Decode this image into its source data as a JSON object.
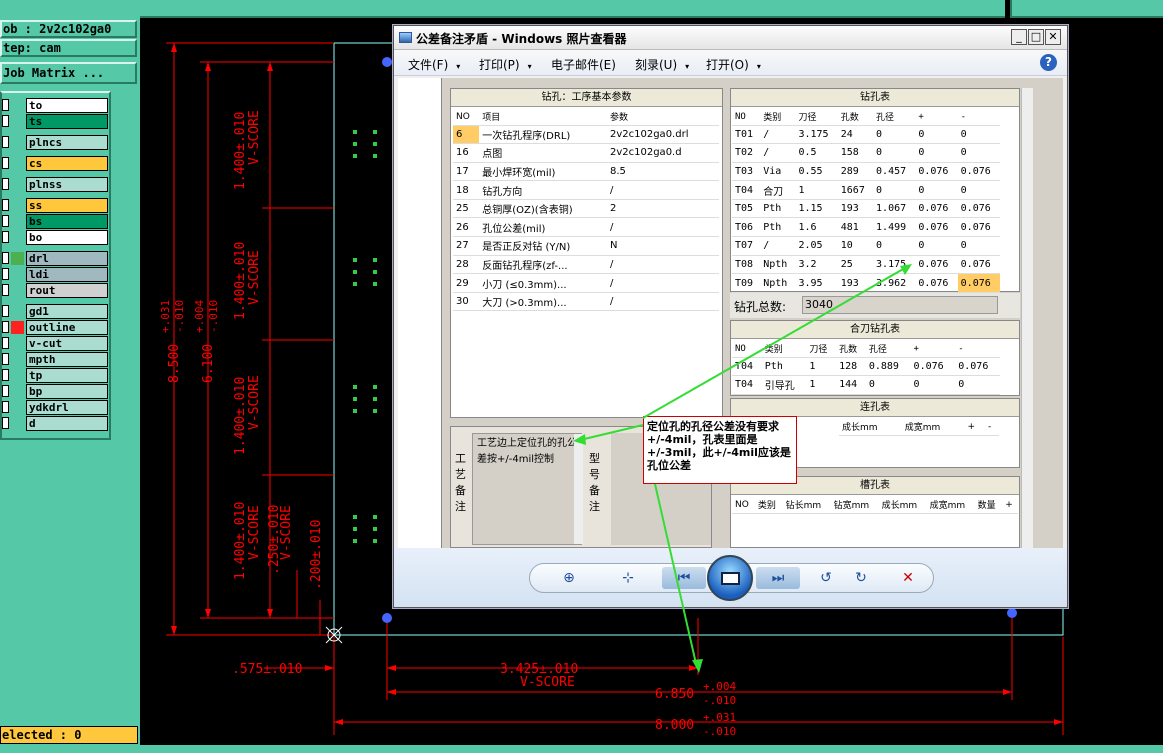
{
  "cad": {
    "job_label": "ob : 2v2c102ga0",
    "step_label": "tep: cam",
    "job_matrix_button": "Job Matrix ...",
    "layers": [
      {
        "name": "to",
        "color": "#ffffff"
      },
      {
        "name": "ts",
        "color": "#009966"
      },
      {
        "name": "plncs",
        "color": "#aaddd0"
      },
      {
        "name": "cs",
        "color": "#ffc83c"
      },
      {
        "name": "plnss",
        "color": "#aaddd0"
      },
      {
        "name": "ss",
        "color": "#ffc83c"
      },
      {
        "name": "bs",
        "color": "#009966"
      },
      {
        "name": "bo",
        "color": "#ffffff"
      },
      {
        "name": "drl",
        "color": "#a0b8c0"
      },
      {
        "name": "ldi",
        "color": "#a0b8c0"
      },
      {
        "name": "rout",
        "color": "#d0d0d0"
      },
      {
        "name": "gd1",
        "color": "#aaddd0"
      },
      {
        "name": "outline",
        "color": "#aaddd0"
      },
      {
        "name": "v-cut",
        "color": "#aaddd0"
      },
      {
        "name": "mpth",
        "color": "#aaddd0"
      },
      {
        "name": "tp",
        "color": "#aaddd0"
      },
      {
        "name": "bp",
        "color": "#aaddd0"
      },
      {
        "name": "ydkdrl",
        "color": "#aaddd0"
      },
      {
        "name": "d",
        "color": "#aaddd0"
      }
    ],
    "selected_status": "elected : 0",
    "dimensions": {
      "v1": "1.400±.010",
      "v2": "1.400±.010",
      "v3": "1.400±.010",
      "v4": "1.400±.010",
      "vscore": "V-SCORE",
      "v250": ".250±.010",
      "v200": ".200±.010",
      "h6100": "6.100",
      "h6100_tol_plus": "+.004",
      "h6100_tol_minus": "-.010",
      "h8500": "8.500",
      "h8500_tol_plus": "+.031",
      "h8500_tol_minus": "-.010",
      "b575": ".575±.010",
      "b3425": "3.425±.010",
      "b6850": "6.850",
      "b6850_plus": "+.004",
      "b6850_minus": "-.010",
      "b8000": "8.000",
      "b8000_plus": "+.031",
      "b8000_minus": "-.010"
    }
  },
  "viewer": {
    "title": "公差备注矛盾 - Windows 照片查看器",
    "menus": [
      "文件(F)",
      "打印(P)",
      "电子邮件(E)",
      "刻录(U)",
      "打开(O)"
    ],
    "menu_arrows": [
      "▾",
      "▾",
      "",
      "▾",
      "▾"
    ],
    "help": "?",
    "win_buttons": {
      "min": "_",
      "max": "□",
      "close": "✕"
    }
  },
  "drill_params": {
    "title": "钻孔：工序基本参数",
    "headers": [
      "NO",
      "项目",
      "参数"
    ],
    "rows": [
      [
        "6",
        "一次钻孔程序(DRL)",
        "2v2c102ga0.drl"
      ],
      [
        "16",
        "点图",
        "2v2c102ga0.d"
      ],
      [
        "17",
        "最小焊环宽(mil)",
        "8.5"
      ],
      [
        "18",
        "钻孔方向",
        "/"
      ],
      [
        "25",
        "总铜厚(OZ)(含表铜)",
        "2"
      ],
      [
        "26",
        "孔位公差(mil)",
        "/"
      ],
      [
        "27",
        "是否正反对钻 (Y/N)",
        "N"
      ],
      [
        "28",
        "反面钻孔程序(zf-...",
        "/"
      ],
      [
        "29",
        "小刀 (≤0.3mm)...",
        "/"
      ],
      [
        "30",
        "大刀 (>0.3mm)...",
        "/"
      ]
    ]
  },
  "drill_table": {
    "title": "钻孔表",
    "headers": [
      "NO",
      "类别",
      "刀径",
      "孔数",
      "孔径",
      "+",
      "-"
    ],
    "rows": [
      [
        "T01",
        "/",
        "3.175",
        "24",
        "0",
        "0",
        "0"
      ],
      [
        "T02",
        "/",
        "0.5",
        "158",
        "0",
        "0",
        "0"
      ],
      [
        "T03",
        "Via",
        "0.55",
        "289",
        "0.457",
        "0.076",
        "0.076"
      ],
      [
        "T04",
        "合刀",
        "1",
        "1667",
        "0",
        "0",
        "0"
      ],
      [
        "T05",
        "Pth",
        "1.15",
        "193",
        "1.067",
        "0.076",
        "0.076"
      ],
      [
        "T06",
        "Pth",
        "1.6",
        "481",
        "1.499",
        "0.076",
        "0.076"
      ],
      [
        "T07",
        "/",
        "2.05",
        "10",
        "0",
        "0",
        "0"
      ],
      [
        "T08",
        "Npth",
        "3.2",
        "25",
        "3.175",
        "0.076",
        "0.076"
      ],
      [
        "T09",
        "Npth",
        "3.95",
        "193",
        "3.962",
        "0.076",
        "0.076"
      ]
    ],
    "total_label": "钻孔总数:",
    "total_value": "3040"
  },
  "combined_table": {
    "title": "合刀钻孔表",
    "headers": [
      "NO",
      "类别",
      "刀径",
      "孔数",
      "孔径",
      "+",
      "-"
    ],
    "rows": [
      [
        "T04",
        "Pth",
        "1",
        "128",
        "0.889",
        "0.076",
        "0.076"
      ],
      [
        "T04",
        "引导孔",
        "1",
        "144",
        "0",
        "0",
        "0"
      ]
    ]
  },
  "link_table": {
    "title": "连孔表",
    "headers": [
      "成长mm",
      "成宽mm",
      "+",
      "-"
    ]
  },
  "slot_table": {
    "title": "槽孔表",
    "headers": [
      "NO",
      "类别",
      "钻长mm",
      "钻宽mm",
      "成长mm",
      "成宽mm",
      "数量",
      "+"
    ]
  },
  "process_note": {
    "label_chars": [
      "工",
      "艺",
      "备",
      "注"
    ],
    "text": "工艺边上定位孔的孔公差按+/-4mil控制",
    "model_label_chars": [
      "型",
      "号",
      "备",
      "注"
    ]
  },
  "annotation": {
    "text": "定位孔的孔径公差没有要求+/-4mil，孔表里面是+/-3mil，此+/-4mil应该是孔位公差"
  }
}
